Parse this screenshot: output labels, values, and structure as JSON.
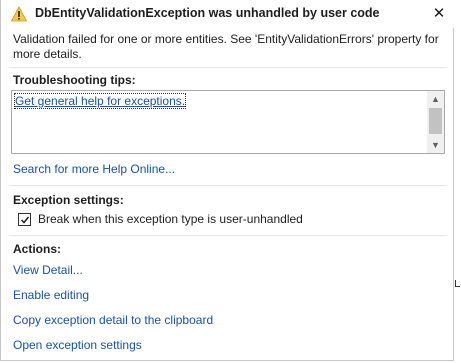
{
  "dialog": {
    "title": "DbEntityValidationException was unhandled by user code",
    "message": "Validation failed for one or more entities. See 'EntityValidationErrors' property for more details.",
    "icons": {
      "title": "warning-icon",
      "close": "close-icon",
      "check": "checkmark-icon"
    },
    "close_glyph": "✕"
  },
  "troubleshooting": {
    "heading": "Troubleshooting tips:",
    "tips": [
      "Get general help for exceptions."
    ],
    "search_link": "Search for more Help Online..."
  },
  "exception_settings": {
    "heading": "Exception settings:",
    "checkbox_label": "Break when this exception type is user-unhandled",
    "checked": true
  },
  "actions": {
    "heading": "Actions:",
    "items": [
      "View Detail...",
      "Enable editing",
      "Copy exception detail to the clipboard",
      "Open exception settings"
    ]
  },
  "colors": {
    "link": "#1a52a5",
    "warning_fill": "#f7c948",
    "separator": "#e6e6e6"
  }
}
